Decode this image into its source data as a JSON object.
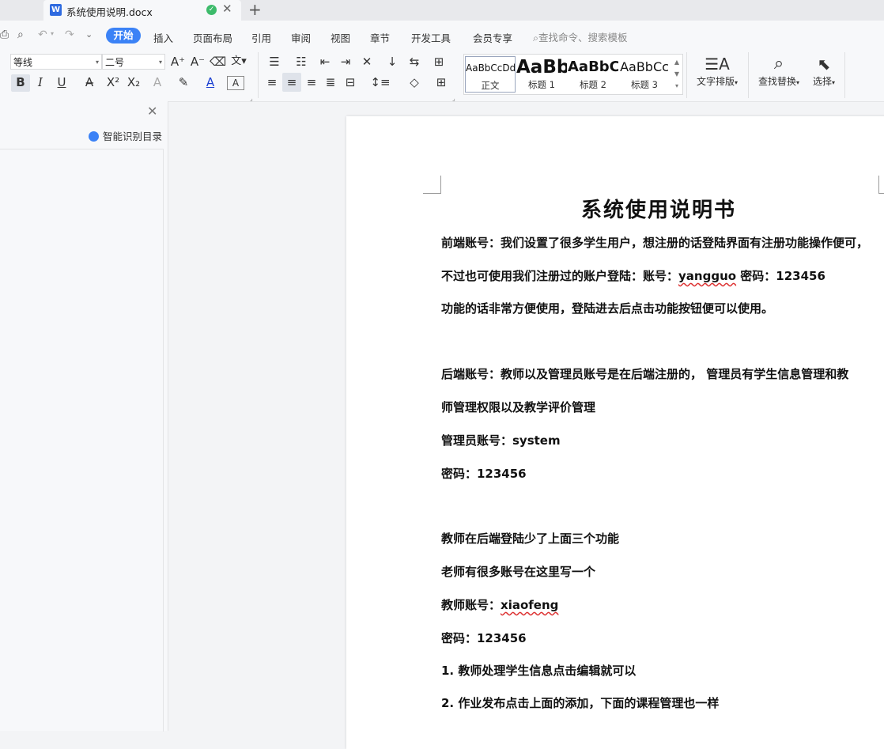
{
  "tab": {
    "title": "系统使用说明.docx",
    "icon_glyph": "W",
    "new_tab": "+"
  },
  "menubar": {
    "active": "开始",
    "items": [
      "插入",
      "页面布局",
      "引用",
      "审阅",
      "视图",
      "章节",
      "开发工具",
      "会员专享"
    ],
    "search": "查找命令、搜索模板"
  },
  "ribbon": {
    "font_name": "等线",
    "font_size": "二号",
    "styles": [
      {
        "sample": "AaBbCcDd",
        "label": "正文"
      },
      {
        "sample": "AaBb",
        "label": "标题 1"
      },
      {
        "sample": "AaBbC",
        "label": "标题 2"
      },
      {
        "sample": "AaBbCc",
        "label": "标题 3"
      }
    ],
    "text_layout": "文字排版",
    "find_replace": "查找替换",
    "select": "选择"
  },
  "left_pane": {
    "smart_toc": "智能识别目录"
  },
  "document": {
    "title": "系统使用说明书",
    "lines": [
      {
        "text": "前端账号：我们设置了很多学生用户，想注册的话登陆界面有注册功能操作便可，"
      },
      {
        "pre": "不过也可使用我们注册过的账户登陆：账号：",
        "wavy": "yangguo",
        "post": " 密码：123456"
      },
      {
        "text": "功能的话非常方便使用，登陆进去后点击功能按钮便可以使用。"
      },
      {
        "text": "后端账号：教师以及管理员账号是在后端注册的， 管理员有学生信息管理和教"
      },
      {
        "text": "师管理权限以及教学评价管理"
      },
      {
        "text": "管理员账号：system"
      },
      {
        "text": "密码：123456"
      },
      {
        "text": "教师在后端登陆少了上面三个功能"
      },
      {
        "text": "老师有很多账号在这里写一个"
      },
      {
        "pre": "教师账号：",
        "wavy": "xiaofeng",
        "post": ""
      },
      {
        "text": "密码：123456"
      },
      {
        "text": "1.  教师处理学生信息点击编辑就可以"
      },
      {
        "text": "2.  作业发布点击上面的添加，下面的课程管理也一样"
      }
    ]
  },
  "colors": {
    "accent": "#3b82f6",
    "saved": "#3dbb6b",
    "spell": "#d33"
  }
}
